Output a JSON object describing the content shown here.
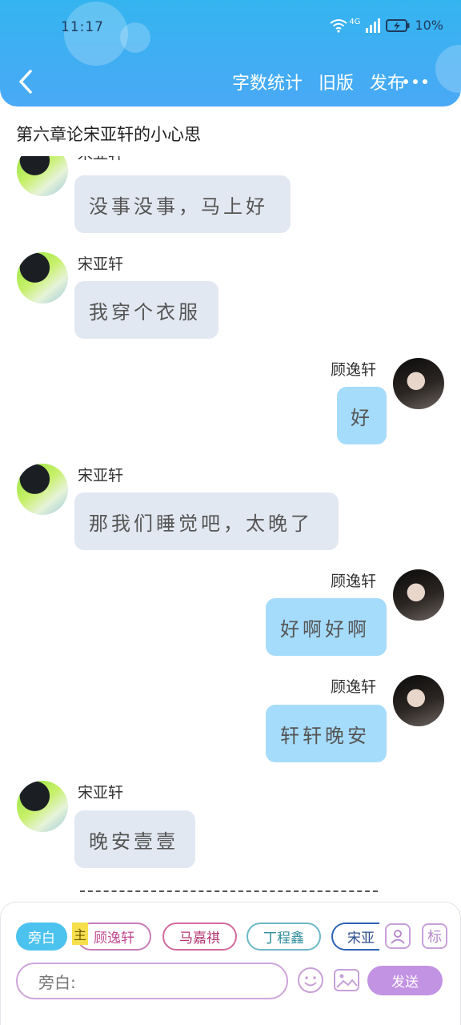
{
  "status_bar": {
    "time": "11:17",
    "network": "4G",
    "battery": "10%"
  },
  "header": {
    "actions": [
      "字数统计",
      "旧版",
      "发布"
    ],
    "bg_color": "#4aa9f6"
  },
  "chapter_title": "第六章论宋亚轩的小心思",
  "messages": [
    {
      "side": "left",
      "sender": "宋亚轩",
      "text": "没事没事，马上好"
    },
    {
      "side": "left",
      "sender": "宋亚轩",
      "text": "我穿个衣服"
    },
    {
      "side": "right",
      "sender": "顾逸轩",
      "text": "好"
    },
    {
      "side": "left",
      "sender": "宋亚轩",
      "text": "那我们睡觉吧，太晚了"
    },
    {
      "side": "right",
      "sender": "顾逸轩",
      "text": "好啊好啊"
    },
    {
      "side": "right",
      "sender": "顾逸轩",
      "text": "轩轩晚安"
    },
    {
      "side": "left",
      "sender": "宋亚轩",
      "text": "晚安壹壹"
    }
  ],
  "roles": {
    "narrator": "旁白",
    "main_tag": "主",
    "items": [
      "顾逸轩",
      "马嘉祺",
      "丁程鑫",
      "宋亚"
    ]
  },
  "tools": {
    "tag_label": "标"
  },
  "input": {
    "placeholder": "旁白:"
  },
  "send_label": "发送",
  "colors": {
    "left_bubble": "#e2e8f1",
    "right_bubble": "#a6dcfb",
    "send": "#c292e3",
    "accent": "#4cc3ef"
  }
}
